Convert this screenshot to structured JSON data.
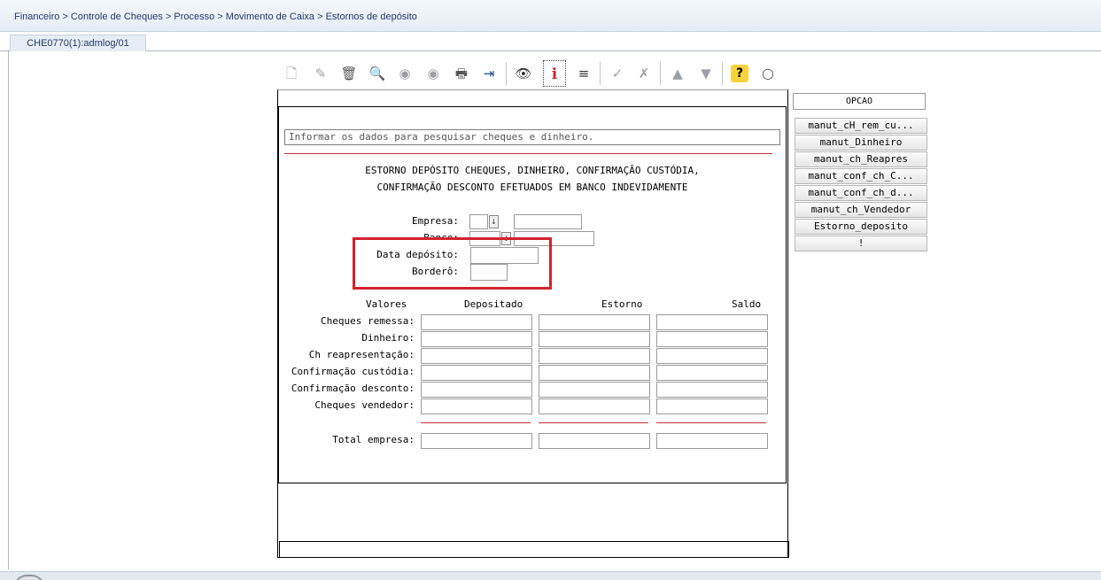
{
  "breadcrumb": {
    "text": "Financeiro > Controle de Cheques > Processo > Movimento de Caixa > Estornos de depósito"
  },
  "tab": {
    "label": "CHE0770(1):admlog/01"
  },
  "toolbar": {
    "buttons": [
      {
        "icon": "new-doc-icon",
        "glyph": "🗋"
      },
      {
        "icon": "edit-icon",
        "glyph": "✎"
      },
      {
        "icon": "trash-icon",
        "glyph": "🗑"
      },
      {
        "icon": "search-icon",
        "glyph": "🔍"
      },
      {
        "icon": "prev-icon",
        "glyph": "◉"
      },
      {
        "icon": "next-icon",
        "glyph": "◉"
      },
      {
        "icon": "print-icon",
        "glyph": "🖶"
      },
      {
        "icon": "exit-icon",
        "glyph": "⇥"
      },
      {
        "icon": "binoculars-icon",
        "glyph": "👁"
      },
      {
        "icon": "info-icon",
        "glyph": "i"
      },
      {
        "icon": "list-icon",
        "glyph": "≡"
      },
      {
        "icon": "check-icon",
        "glyph": "✓"
      },
      {
        "icon": "cancel-icon",
        "glyph": "✗"
      },
      {
        "icon": "up-icon",
        "glyph": "▲"
      },
      {
        "icon": "down-icon",
        "glyph": "▼"
      },
      {
        "icon": "help-icon",
        "glyph": "?"
      },
      {
        "icon": "chat-icon",
        "glyph": "◯"
      }
    ]
  },
  "form": {
    "search_text": "Informar os dados para pesquisar cheques e dinheiro.",
    "title_line1": "ESTORNO DEPÓSITO CHEQUES, DINHEIRO, CONFIRMAÇÃO CUSTÓDIA,",
    "title_line2": "CONFIRMAÇÃO DESCONTO EFETUADOS EM BANCO INDEVIDAMENTE",
    "empresa_label": "Empresa:",
    "banco_label": "Banco:",
    "data_deposito_label": "Data depósito:",
    "bordero_label": "Borderô:",
    "columns": [
      "Valores",
      "Depositado",
      "Estorno",
      "Saldo"
    ],
    "rows": [
      "Cheques remessa:",
      "Dinheiro:",
      "Ch reapresentação:",
      "Confirmação custódia:",
      "Confirmação desconto:",
      "Cheques vendedor:"
    ],
    "total_label": "Total empresa:"
  },
  "side": {
    "opcao_label": "OPCAO",
    "buttons": [
      "manut_cH_rem_cu...",
      "manut_Dinheiro",
      "manut_ch_Reapres",
      "manut_conf_ch_C...",
      "manut_conf_ch_d...",
      "manut_ch_Vendedor",
      "Estorno_deposito",
      "!"
    ]
  },
  "colors": {
    "highlight": "#d3212e",
    "separator": "#c4303a",
    "header_bg": "#e4ecf4",
    "link": "#1f3a6b"
  }
}
